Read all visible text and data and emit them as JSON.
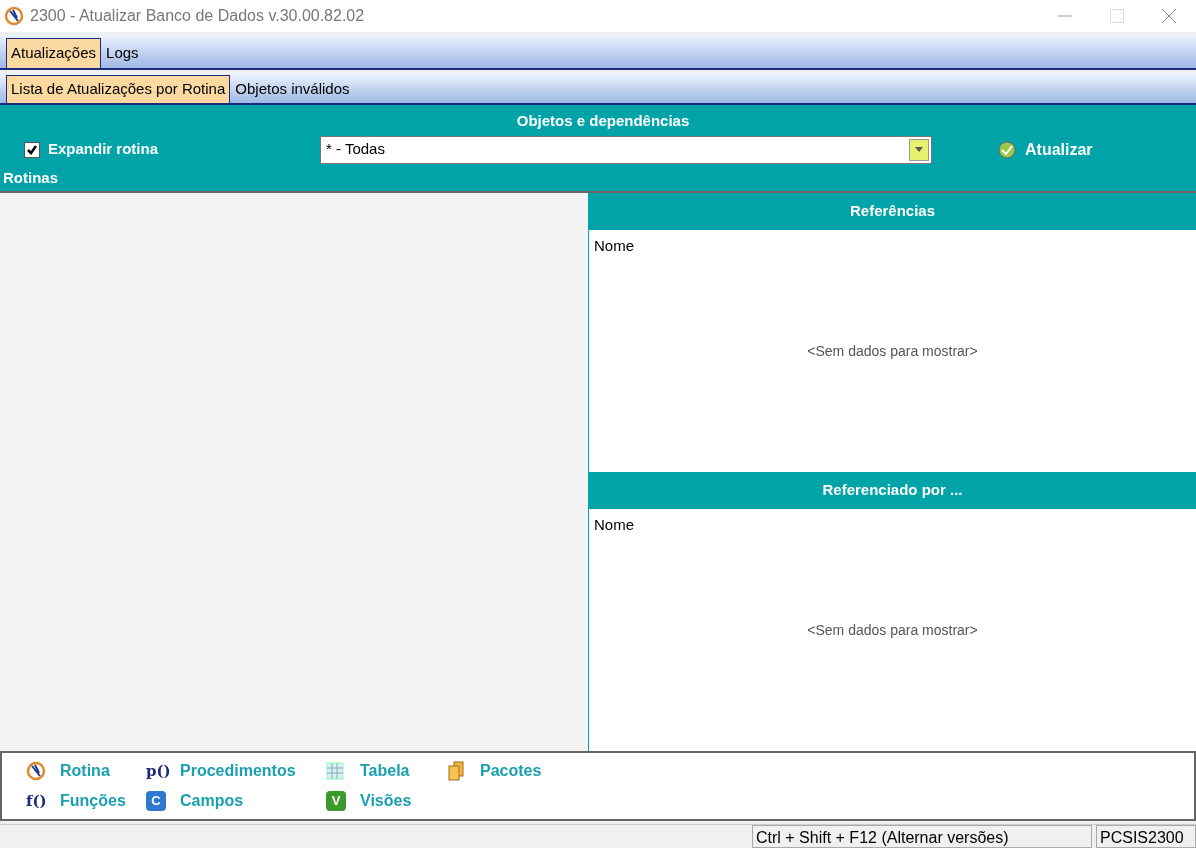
{
  "window": {
    "title": "2300 - Atualizar Banco de Dados v.30.00.82.02"
  },
  "tabs": [
    {
      "label": "Atualizações",
      "selected": true
    },
    {
      "label": "Logs",
      "selected": false
    }
  ],
  "subtabs": [
    {
      "label": "Lista de Atualizações por Rotina",
      "selected": true
    },
    {
      "label": "Objetos inválidos",
      "selected": false
    }
  ],
  "toolbar": {
    "heading": "Objetos e dependências",
    "expand": {
      "label": "Expandir rotina",
      "checked": true
    },
    "filter": {
      "value": "* - Todas"
    },
    "update_button": "Atualizar",
    "rotinas_label": "Rotinas"
  },
  "panels": [
    {
      "title": "Referências",
      "column": "Nome",
      "empty": "<Sem dados para mostrar>"
    },
    {
      "title": "Referenciado por ...",
      "column": "Nome",
      "empty": "<Sem dados para mostrar>"
    }
  ],
  "legend": [
    {
      "kind": "rotina",
      "label": "Rotina"
    },
    {
      "kind": "proc",
      "label": "Procedimentos",
      "glyph": "p()"
    },
    {
      "kind": "tabela",
      "label": "Tabela"
    },
    {
      "kind": "pacote",
      "label": "Pacotes"
    },
    {
      "kind": "func",
      "label": "Funções",
      "glyph": "f()"
    },
    {
      "kind": "campo",
      "label": "Campos",
      "glyph": "C"
    },
    {
      "kind": "visao",
      "label": "Visões",
      "glyph": "V"
    }
  ],
  "status_bar": [
    "Ctrl + Shift + F12 (Alternar versões)",
    "PCSIS2300"
  ]
}
